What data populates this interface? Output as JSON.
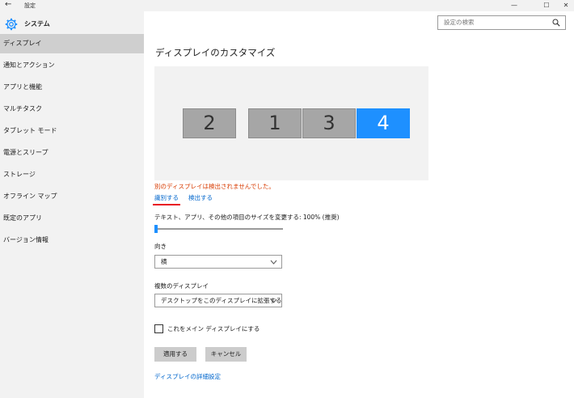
{
  "window": {
    "back_glyph": "←",
    "title": "設定",
    "minimize_glyph": "—",
    "maximize_glyph": "☐",
    "close_glyph": "✕"
  },
  "sidebar": {
    "header": "システム",
    "items": [
      {
        "label": "ディスプレイ",
        "active": true
      },
      {
        "label": "通知とアクション"
      },
      {
        "label": "アプリと機能"
      },
      {
        "label": "マルチタスク"
      },
      {
        "label": "タブレット モード"
      },
      {
        "label": "電源とスリープ"
      },
      {
        "label": "ストレージ"
      },
      {
        "label": "オフライン マップ"
      },
      {
        "label": "既定のアプリ"
      },
      {
        "label": "バージョン情報"
      }
    ]
  },
  "search": {
    "placeholder": "設定の検索",
    "icon": "search-icon"
  },
  "main": {
    "title": "ディスプレイのカスタマイズ",
    "monitors": [
      {
        "number": "2",
        "selected": false
      },
      {
        "number": "1",
        "selected": false
      },
      {
        "number": "3",
        "selected": false
      },
      {
        "number": "4",
        "selected": true
      }
    ],
    "warning": "別のディスプレイは検出されませんでした。",
    "identify_link": "識別する",
    "detect_link": "検出する",
    "scale_label": "テキスト、アプリ、その他の項目のサイズを変更する: 100% (推奨)",
    "scale_slider_fraction": 0,
    "orientation_label": "向き",
    "orientation_value": "横",
    "multi_display_label": "複数のディスプレイ",
    "multi_display_value": "デスクトップをこのディスプレイに拡張する",
    "main_display_checkbox": "これをメイン ディスプレイにする",
    "main_display_checked": false,
    "apply_button": "適用する",
    "cancel_button": "キャンセル",
    "advanced_link": "ディスプレイの詳細設定"
  },
  "colors": {
    "accent": "#1e90ff",
    "warning": "#d83b01",
    "link": "#0066cc",
    "underline": "#e81123",
    "sidebar_bg": "#f2f2f2",
    "sidebar_active": "#cfcfcf",
    "monitor_gray": "#a6a6a6"
  }
}
